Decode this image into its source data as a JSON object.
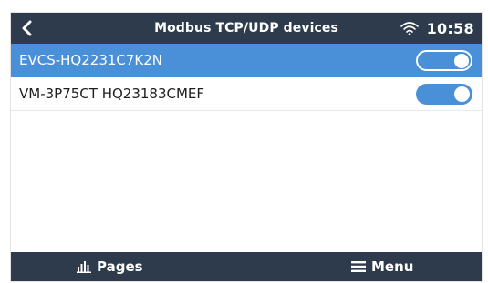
{
  "header": {
    "title": "Modbus TCP/UDP devices",
    "clock": "10:58",
    "back_icon": "chevron-left-icon",
    "wifi_icon": "wifi-icon"
  },
  "devices": [
    {
      "name": "EVCS-HQ2231C7K2N",
      "enabled": true,
      "selected": true
    },
    {
      "name": "VM-3P75CT HQ23183CMEF",
      "enabled": true,
      "selected": false
    }
  ],
  "footer": {
    "pages_label": "Pages",
    "pages_icon": "bar-chart-icon",
    "menu_label": "Menu",
    "menu_icon": "hamburger-icon"
  },
  "colors": {
    "header_bg": "#2d3b4c",
    "accent": "#4a90d9",
    "text": "#1e1e1e"
  }
}
